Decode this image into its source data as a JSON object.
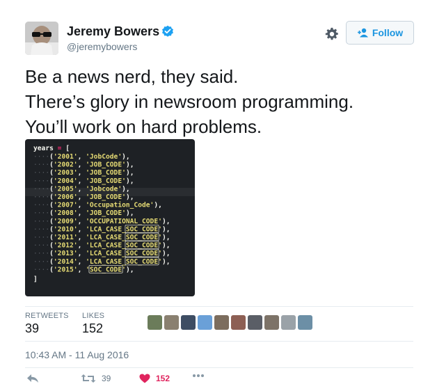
{
  "user": {
    "name": "Jeremy Bowers",
    "handle": "@jeremybowers",
    "verified": true,
    "avatar_icon": "avatar-photo"
  },
  "actions_top": {
    "settings_icon": "gear-icon",
    "follow_label": "Follow",
    "follow_icon": "add-user-icon"
  },
  "tweet": {
    "lines": [
      "Be a news nerd, they said.",
      "There’s glory in newsroom programming.",
      "You’ll work on hard problems."
    ]
  },
  "code_image": {
    "header": "years = [",
    "rows": [
      {
        "year": "'2001'",
        "code": "'JobCode'",
        "box": false
      },
      {
        "year": "'2002'",
        "code": "'JOB_CODE'",
        "box": false
      },
      {
        "year": "'2003'",
        "code": "'JOB_CODE'",
        "box": false
      },
      {
        "year": "'2004'",
        "code": "'JOB_CODE'",
        "box": false
      },
      {
        "year": "'2005'",
        "code": "'Jobcode'",
        "box": false
      },
      {
        "year": "'2006'",
        "code": "'JOB_CODE'",
        "box": false
      },
      {
        "year": "'2007'",
        "code": "'Occupation_Code'",
        "box": false
      },
      {
        "year": "'2008'",
        "code": "'JOB_CODE'",
        "box": false
      },
      {
        "year": "'2009'",
        "code": "'OCCUPATIONAL_CODE'",
        "box": false
      },
      {
        "year": "'2010'",
        "code": "'LCA_CASE_SOC_CODE'",
        "box": true
      },
      {
        "year": "'2011'",
        "code": "'LCA_CASE_SOC_CODE'",
        "box": true
      },
      {
        "year": "'2012'",
        "code": "'LCA_CASE_SOC_CODE'",
        "box": true
      },
      {
        "year": "'2013'",
        "code": "'LCA_CASE_SOC_CODE'",
        "box": true
      },
      {
        "year": "'2014'",
        "code": "'LCA_CASE_SOC_CODE'",
        "box": true
      },
      {
        "year": "'2015'",
        "code": "'SOC_CODE'",
        "box": true
      }
    ],
    "footer": "]",
    "colors": {
      "bg": "#1e2125",
      "year": "#e6db74",
      "code": "#e6db74",
      "punct": "#f8f8f2",
      "keyword": "#f8f8f2",
      "operator": "#f92672"
    }
  },
  "stats": {
    "retweets_label": "RETWEETS",
    "retweets_value": "39",
    "likes_label": "LIKES",
    "likes_value": "152"
  },
  "likers": [
    "#6b7c5a",
    "#8a8070",
    "#3e4d63",
    "#6aa0d8",
    "#7c6d5e",
    "#8d5f54",
    "#5a5e66",
    "#7d7368",
    "#9aa2a8",
    "#6c8fa6"
  ],
  "timestamp": "10:43 AM - 11 Aug 2016",
  "footer_actions": {
    "reply_icon": "reply-icon",
    "retweet_icon": "retweet-icon",
    "retweet_count": "39",
    "like_icon": "heart-icon",
    "like_count": "152",
    "more_icon": "more-icon"
  },
  "accent": "#1b95e0",
  "like_color": "#e0245e"
}
